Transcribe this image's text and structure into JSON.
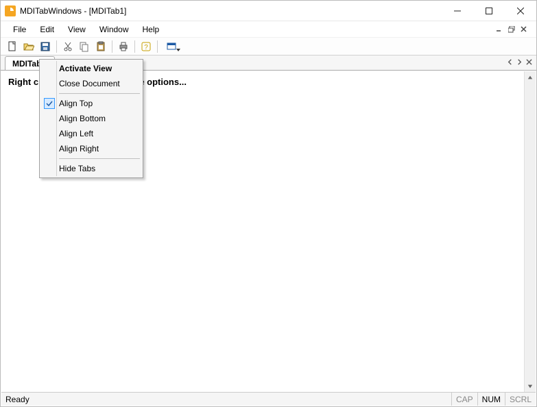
{
  "window": {
    "title": "MDITabWindows - [MDITab1]"
  },
  "menu": {
    "items": [
      "File",
      "Edit",
      "View",
      "Window",
      "Help"
    ]
  },
  "toolbar_icons": [
    "new",
    "open",
    "save",
    "cut",
    "copy",
    "paste",
    "print",
    "help",
    "windows"
  ],
  "tab": {
    "label": "MDITab1"
  },
  "content": {
    "text_visible_left": "Right c",
    "text_visible_right": "e options..."
  },
  "context_menu": {
    "items": [
      {
        "label": "Activate View",
        "bold": true,
        "checked": false
      },
      {
        "label": "Close Document",
        "bold": false,
        "checked": false
      },
      {
        "sep": true
      },
      {
        "label": "Align Top",
        "bold": false,
        "checked": true
      },
      {
        "label": "Align Bottom",
        "bold": false,
        "checked": false
      },
      {
        "label": "Align Left",
        "bold": false,
        "checked": false
      },
      {
        "label": "Align Right",
        "bold": false,
        "checked": false
      },
      {
        "sep": true
      },
      {
        "label": "Hide Tabs",
        "bold": false,
        "checked": false
      }
    ]
  },
  "status": {
    "ready": "Ready",
    "cap": "CAP",
    "num": "NUM",
    "scrl": "SCRL"
  }
}
